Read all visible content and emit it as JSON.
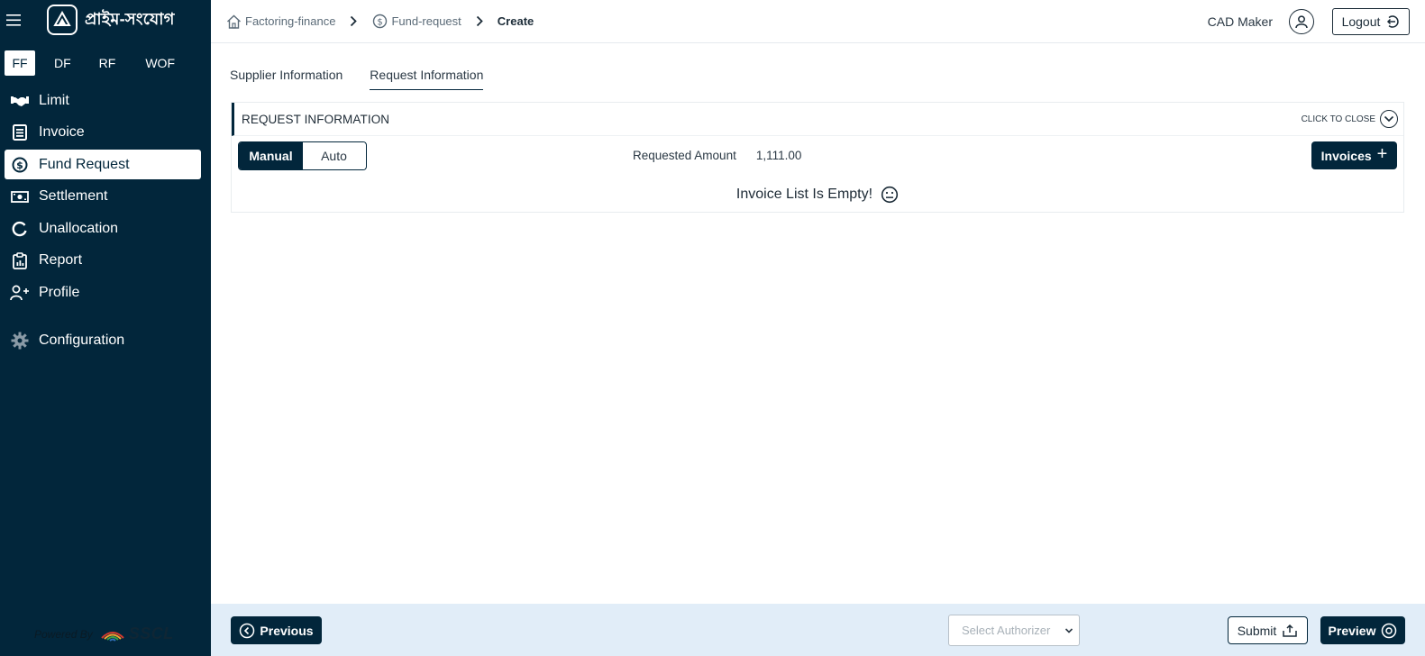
{
  "sidebar": {
    "brand_name": "প্রাইম-সংযোগ",
    "product_tabs": [
      "FF",
      "DF",
      "RF",
      "WOF"
    ],
    "active_product": "FF",
    "items": [
      {
        "label": "Limit",
        "icon": "handshake-icon"
      },
      {
        "label": "Invoice",
        "icon": "document-list-icon"
      },
      {
        "label": "Fund Request",
        "icon": "dollar-circle-icon",
        "active": true
      },
      {
        "label": "Settlement",
        "icon": "banknote-icon"
      },
      {
        "label": "Unallocation",
        "icon": "refresh-circle-icon"
      },
      {
        "label": "Report",
        "icon": "clipboard-chart-icon"
      },
      {
        "label": "Profile",
        "icon": "user-plus-icon"
      },
      {
        "label": "Configuration",
        "icon": "gear-icon"
      }
    ],
    "powered_by": "Powered By",
    "powered_brand": "SSCL"
  },
  "header": {
    "breadcrumbs": [
      {
        "label": "Factoring-finance",
        "icon": "home-icon"
      },
      {
        "label": "Fund-request",
        "icon": "dollar-circle-icon"
      },
      {
        "label": "Create"
      }
    ],
    "user_name": "CAD Maker",
    "logout_label": "Logout"
  },
  "tabs": [
    {
      "label": "Supplier Information",
      "active": false
    },
    {
      "label": "Request Information",
      "active": true
    }
  ],
  "panel": {
    "title": "REQUEST INFORMATION",
    "close_label": "CLICK TO CLOSE",
    "mode_options": [
      "Manual",
      "Auto"
    ],
    "selected_mode": "Manual",
    "requested_amount_label": "Requested Amount",
    "requested_amount_value": "1,111.00",
    "invoices_button": "Invoices",
    "empty_message": "Invoice List Is Empty!"
  },
  "footer": {
    "previous_label": "Previous",
    "authorizer_placeholder": "Select Authorizer",
    "submit_label": "Submit",
    "preview_label": "Preview"
  },
  "colors": {
    "primary": "#02263b",
    "footer_bg": "#e1edf8"
  }
}
